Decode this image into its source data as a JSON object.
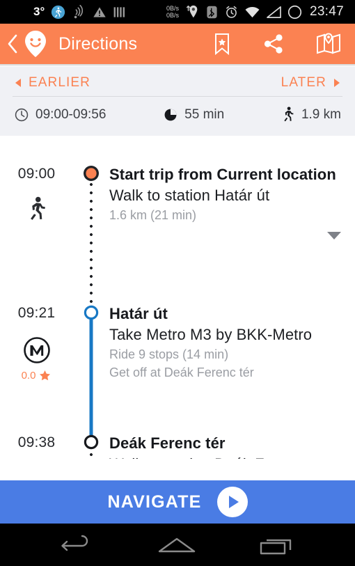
{
  "statusbar": {
    "temperature": "3°",
    "net_speed_down": "0B/s",
    "net_speed_up": "0B/s",
    "clock": "23:47",
    "icons": [
      "running-man-icon",
      "satellite-signal-icon",
      "warning-triangle-icon",
      "bars-icon",
      "location-pin-icon",
      "bluetooth-icon",
      "alarm-clock-icon",
      "wifi-icon",
      "cell-signal-icon",
      "circle-icon"
    ]
  },
  "appbar": {
    "title": "Directions",
    "back_icon": "back-chevron-icon",
    "logo_icon": "smiley-map-pin-icon",
    "actions": [
      "bookmark-star-icon",
      "share-icon",
      "map-icon"
    ]
  },
  "summary": {
    "earlier_label": "EARLIER",
    "later_label": "LATER",
    "stats": [
      {
        "icon": "clock-icon",
        "value": "09:00-09:56"
      },
      {
        "icon": "duration-pie-icon",
        "value": "55 min"
      },
      {
        "icon": "walking-icon",
        "value": "1.9 km"
      }
    ]
  },
  "itinerary": [
    {
      "time": "09:00",
      "mode_icon": "walking-icon",
      "marker": "origin-dot",
      "title": "Start trip from Current location",
      "subtitle": "Walk to station Határ út",
      "meta": "1.6 km (21  min)",
      "has_expander": true
    },
    {
      "time": "09:21",
      "mode_icon": "metro-m-icon",
      "marker": "transit-circle-blue",
      "rating": "0.0",
      "rating_icon": "star-icon",
      "title": "Határ út",
      "subtitle": "Take Metro M3 by BKK-Metro",
      "meta": "Ride 9 stops (14  min)",
      "meta2": "Get off at Deák Ferenc tér",
      "has_expander": false
    },
    {
      "time": "09:38",
      "marker": "transit-circle-black",
      "title": "Deák Ferenc tér",
      "subtitle": "Walk to station Deák Ferenc",
      "has_expander": false
    }
  ],
  "navigate": {
    "label": "NAVIGATE",
    "play_icon": "play-icon"
  },
  "androidnav": {
    "back_icon": "android-back-icon",
    "home_icon": "android-home-icon",
    "recents_icon": "android-recents-icon"
  },
  "colors": {
    "accent_orange": "#fb8252",
    "transit_blue": "#1878c4",
    "navigate_blue": "#4a7ce4",
    "header_bg": "#f0f1f5"
  }
}
